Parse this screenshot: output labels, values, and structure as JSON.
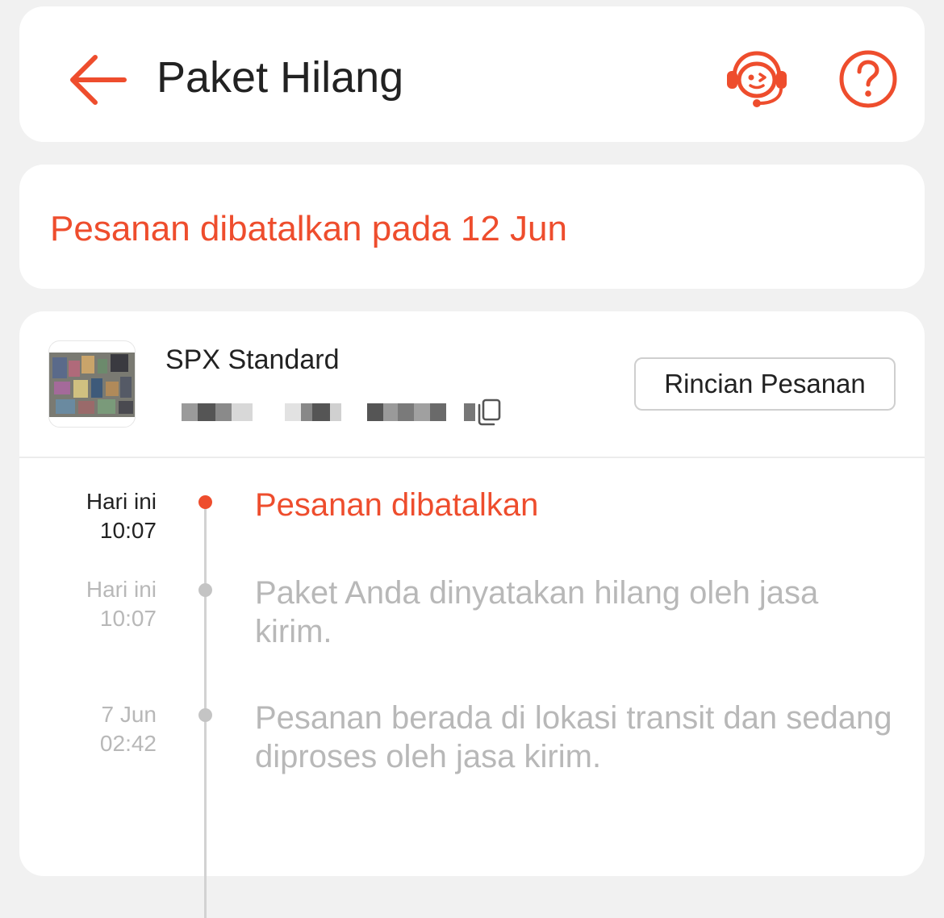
{
  "header": {
    "title": "Paket Hilang",
    "back_icon": "arrow-left-icon",
    "support_icon": "customer-service-icon",
    "help_icon": "question-circle-icon"
  },
  "status": {
    "message": "Pesanan dibatalkan pada 12 Jun"
  },
  "shipment": {
    "courier": "SPX Standard",
    "tracking_number": "",
    "copy_icon": "copy-icon",
    "order_details_button": "Rincian Pesanan"
  },
  "timeline": [
    {
      "date": "Hari ini",
      "time": "10:07",
      "text": "Pesanan dibatalkan",
      "active": true
    },
    {
      "date": "Hari ini",
      "time": "10:07",
      "text": "Paket Anda dinyatakan hilang oleh jasa kirim.",
      "active": false
    },
    {
      "date": "7 Jun",
      "time": "02:42",
      "text": "Pesanan berada di lokasi transit dan sedang diproses oleh jasa kirim.",
      "active": false
    }
  ],
  "colors": {
    "accent": "#ee4d2d",
    "text_primary": "#222222",
    "text_muted": "#b8b8b8",
    "background": "#f1f1f1"
  }
}
